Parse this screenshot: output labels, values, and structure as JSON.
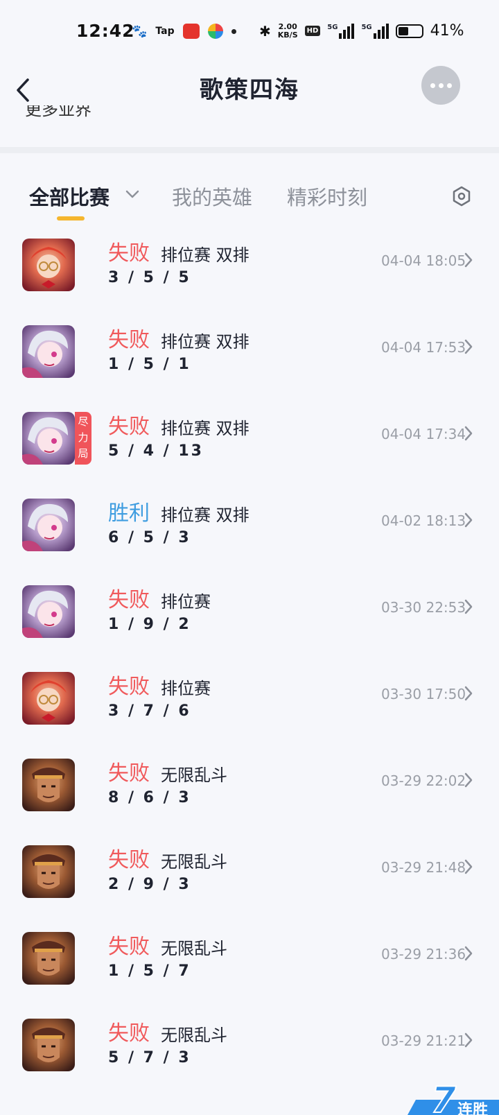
{
  "status_bar": {
    "time": "12:42",
    "tap_label": "Tap",
    "speed": "2.00",
    "speed_unit": "KB/S",
    "hd_label": "HD",
    "net1": "5G",
    "net2": "5G",
    "battery": "41%"
  },
  "header": {
    "title": "歌策四海",
    "cut_text": "更多业界"
  },
  "tabs": {
    "all_matches": "全部比赛",
    "my_heroes": "我的英雄",
    "highlights": "精彩时刻"
  },
  "matches": [
    {
      "result": "失败",
      "mode": "排位赛 双排",
      "kda": "3/5/5",
      "time": "04-04 18:05",
      "hero": "a"
    },
    {
      "result": "失败",
      "mode": "排位赛 双排",
      "kda": "1/5/1",
      "time": "04-04 17:53",
      "hero": "b"
    },
    {
      "result": "失败",
      "mode": "排位赛 双排",
      "kda": "5/4/13",
      "time": "04-04 17:34",
      "hero": "b",
      "badge": "尽力局"
    },
    {
      "result": "胜利",
      "mode": "排位赛 双排",
      "kda": "6/5/3",
      "time": "04-02 18:13",
      "hero": "b"
    },
    {
      "result": "失败",
      "mode": "排位赛",
      "kda": "1/9/2",
      "time": "03-30 22:53",
      "hero": "b"
    },
    {
      "result": "失败",
      "mode": "排位赛",
      "kda": "3/7/6",
      "time": "03-30 17:50",
      "hero": "a"
    },
    {
      "result": "失败",
      "mode": "无限乱斗",
      "kda": "8/6/3",
      "time": "03-29 22:02",
      "hero": "c"
    },
    {
      "result": "失败",
      "mode": "无限乱斗",
      "kda": "2/9/3",
      "time": "03-29 21:48",
      "hero": "c"
    },
    {
      "result": "失败",
      "mode": "无限乱斗",
      "kda": "1/5/7",
      "time": "03-29 21:36",
      "hero": "c"
    },
    {
      "result": "失败",
      "mode": "无限乱斗",
      "kda": "5/7/3",
      "time": "03-29 21:21",
      "hero": "c"
    }
  ],
  "streak": {
    "count": "7",
    "label": "连胜"
  },
  "colors": {
    "lose": "#f05a5c",
    "win": "#3f9de0",
    "accent": "#f5b62e"
  }
}
